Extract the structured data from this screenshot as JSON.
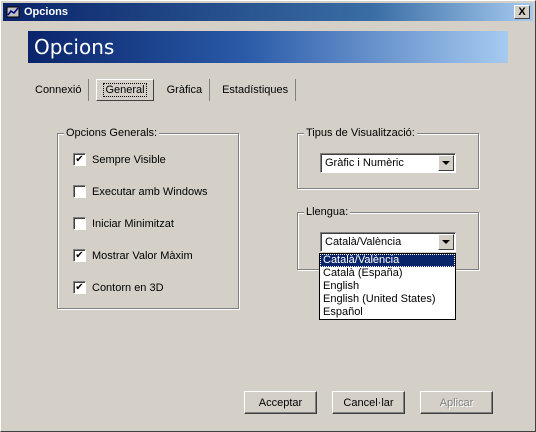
{
  "window": {
    "title": "Opcions",
    "close_label": "X"
  },
  "banner": {
    "title": "Opcions"
  },
  "tabs": [
    {
      "label": "Connexió",
      "active": false
    },
    {
      "label": "General",
      "active": true
    },
    {
      "label": "Gràfica",
      "active": false
    },
    {
      "label": "Estadístiques",
      "active": false
    }
  ],
  "general_options": {
    "label": "Opcions Generals:",
    "items": [
      {
        "label": "Sempre Visible",
        "checked": true
      },
      {
        "label": "Executar amb Windows",
        "checked": false
      },
      {
        "label": "Iniciar Minimitzat",
        "checked": false
      },
      {
        "label": "Mostrar Valor Màxim",
        "checked": true
      },
      {
        "label": "Contorn en 3D",
        "checked": true
      }
    ]
  },
  "visualization": {
    "label": "Tipus de Visualització:",
    "selected": "Gràfic i Numèric"
  },
  "language": {
    "label": "Llengua:",
    "selected": "Català/València",
    "options": [
      "Català/València",
      "Català (España)",
      "English",
      "English (United States)",
      "Español"
    ]
  },
  "buttons": {
    "accept": "Acceptar",
    "cancel": "Cancel·lar",
    "apply": "Aplicar"
  },
  "colors": {
    "selection": "#0a246a",
    "face": "#d4d0c8"
  }
}
